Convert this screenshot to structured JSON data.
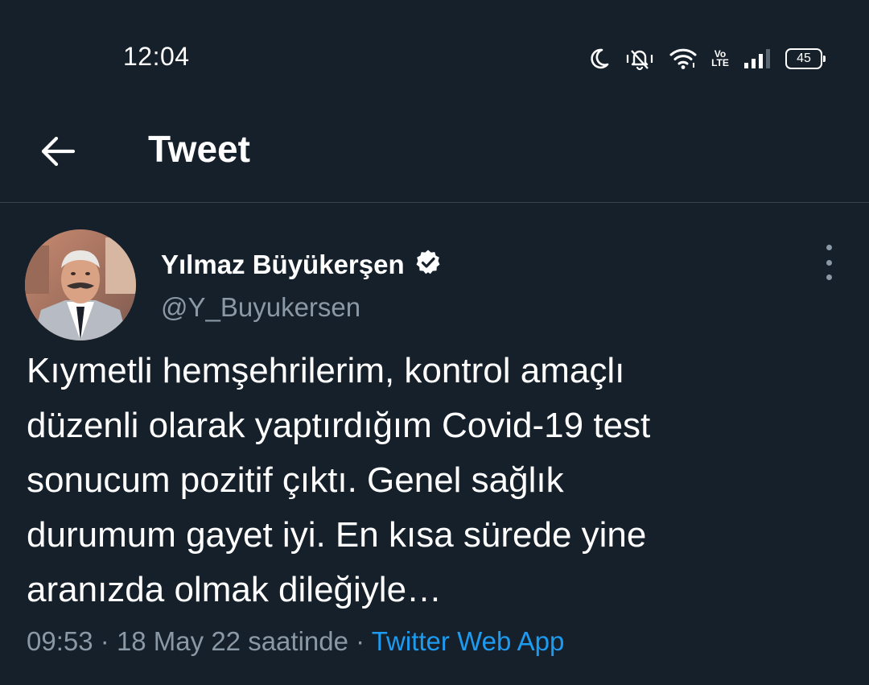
{
  "status_bar": {
    "time": "12:04",
    "icons": [
      "moon-icon",
      "vibrate-icon",
      "wifi-icon",
      "volte-icon",
      "signal-icon",
      "battery-icon"
    ],
    "volte_top": "Vo",
    "volte_bottom": "LTE",
    "battery": "45"
  },
  "header": {
    "back_icon": "arrow-left-icon",
    "title": "Tweet"
  },
  "tweet": {
    "author": {
      "name": "Yılmaz Büyükerşen",
      "handle": "@Y_Buyukersen",
      "verified": true
    },
    "text": "Kıymetli hemşehrilerim, kontrol amaçlı\ndüzenli olarak yaptırdığım Covid-19 test\nsonucum pozitif çıktı. Genel sağlık\ndurumum gayet iyi. En kısa sürede yine\naranızda olmak dileğiyle…",
    "time": "09:53",
    "separator": "·",
    "date": "18 May 22 saatinde",
    "source": "Twitter Web App"
  },
  "colors": {
    "background": "#15202b",
    "text_primary": "#ffffff",
    "text_secondary": "#8b98a5",
    "accent": "#1d9bf0",
    "divider": "#38444d"
  }
}
